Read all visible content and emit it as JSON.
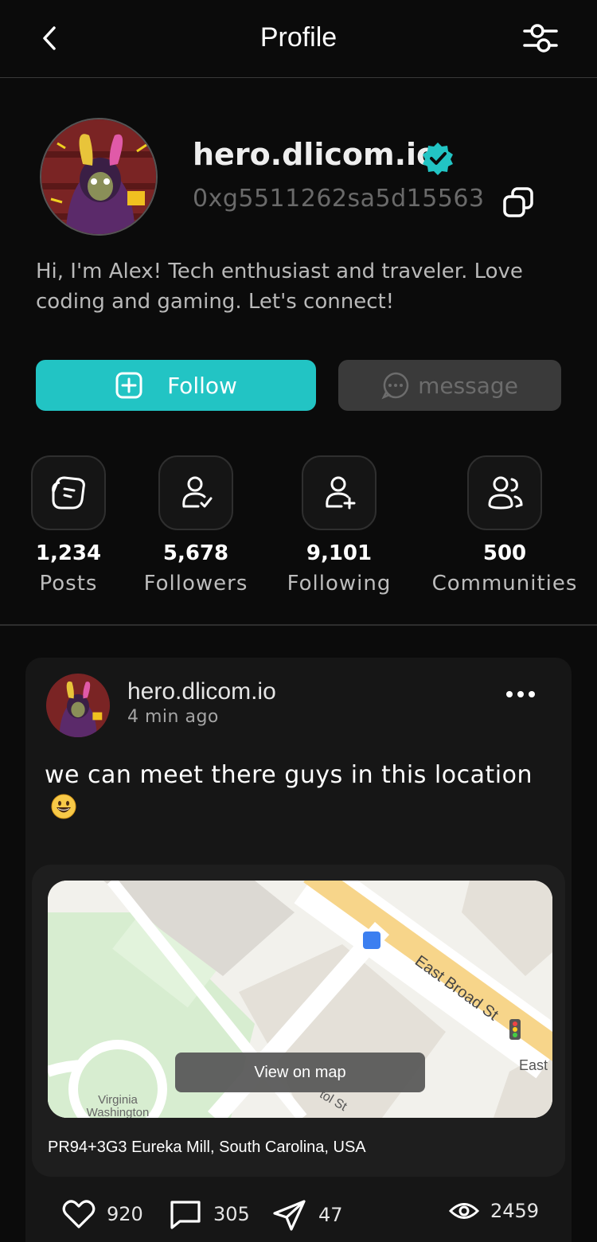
{
  "header": {
    "title": "Profile"
  },
  "profile": {
    "username": "hero.dlicom.io",
    "wallet": "0xg5511262sa5d15563",
    "bio": "Hi, I'm Alex! Tech enthusiast and traveler. Love coding and gaming. Let's connect!"
  },
  "actions": {
    "follow_label": "Follow",
    "message_label": "message"
  },
  "stats": [
    {
      "value": "1,234",
      "label": "Posts",
      "icon": "posts-icon"
    },
    {
      "value": "5,678",
      "label": "Followers",
      "icon": "followers-icon"
    },
    {
      "value": "9,101",
      "label": "Following",
      "icon": "following-icon"
    },
    {
      "value": "500",
      "label": "Communities",
      "icon": "communities-icon"
    }
  ],
  "post": {
    "author": "hero.dlicom.io",
    "time": "4 min ago",
    "text": "we can meet there guys in this location",
    "map": {
      "street_label": "East Broad St",
      "street_label_2": "East",
      "street_label_3": "tol St",
      "park_label": "Virginia Washington",
      "button_label": "View on map"
    },
    "address": "PR94+3G3 Eureka Mill, South Carolina, USA",
    "likes": "920",
    "comments": "305",
    "shares": "47",
    "views": "2459"
  },
  "colors": {
    "accent": "#22c4c4",
    "background": "#0b0b0b",
    "card": "#161616"
  }
}
